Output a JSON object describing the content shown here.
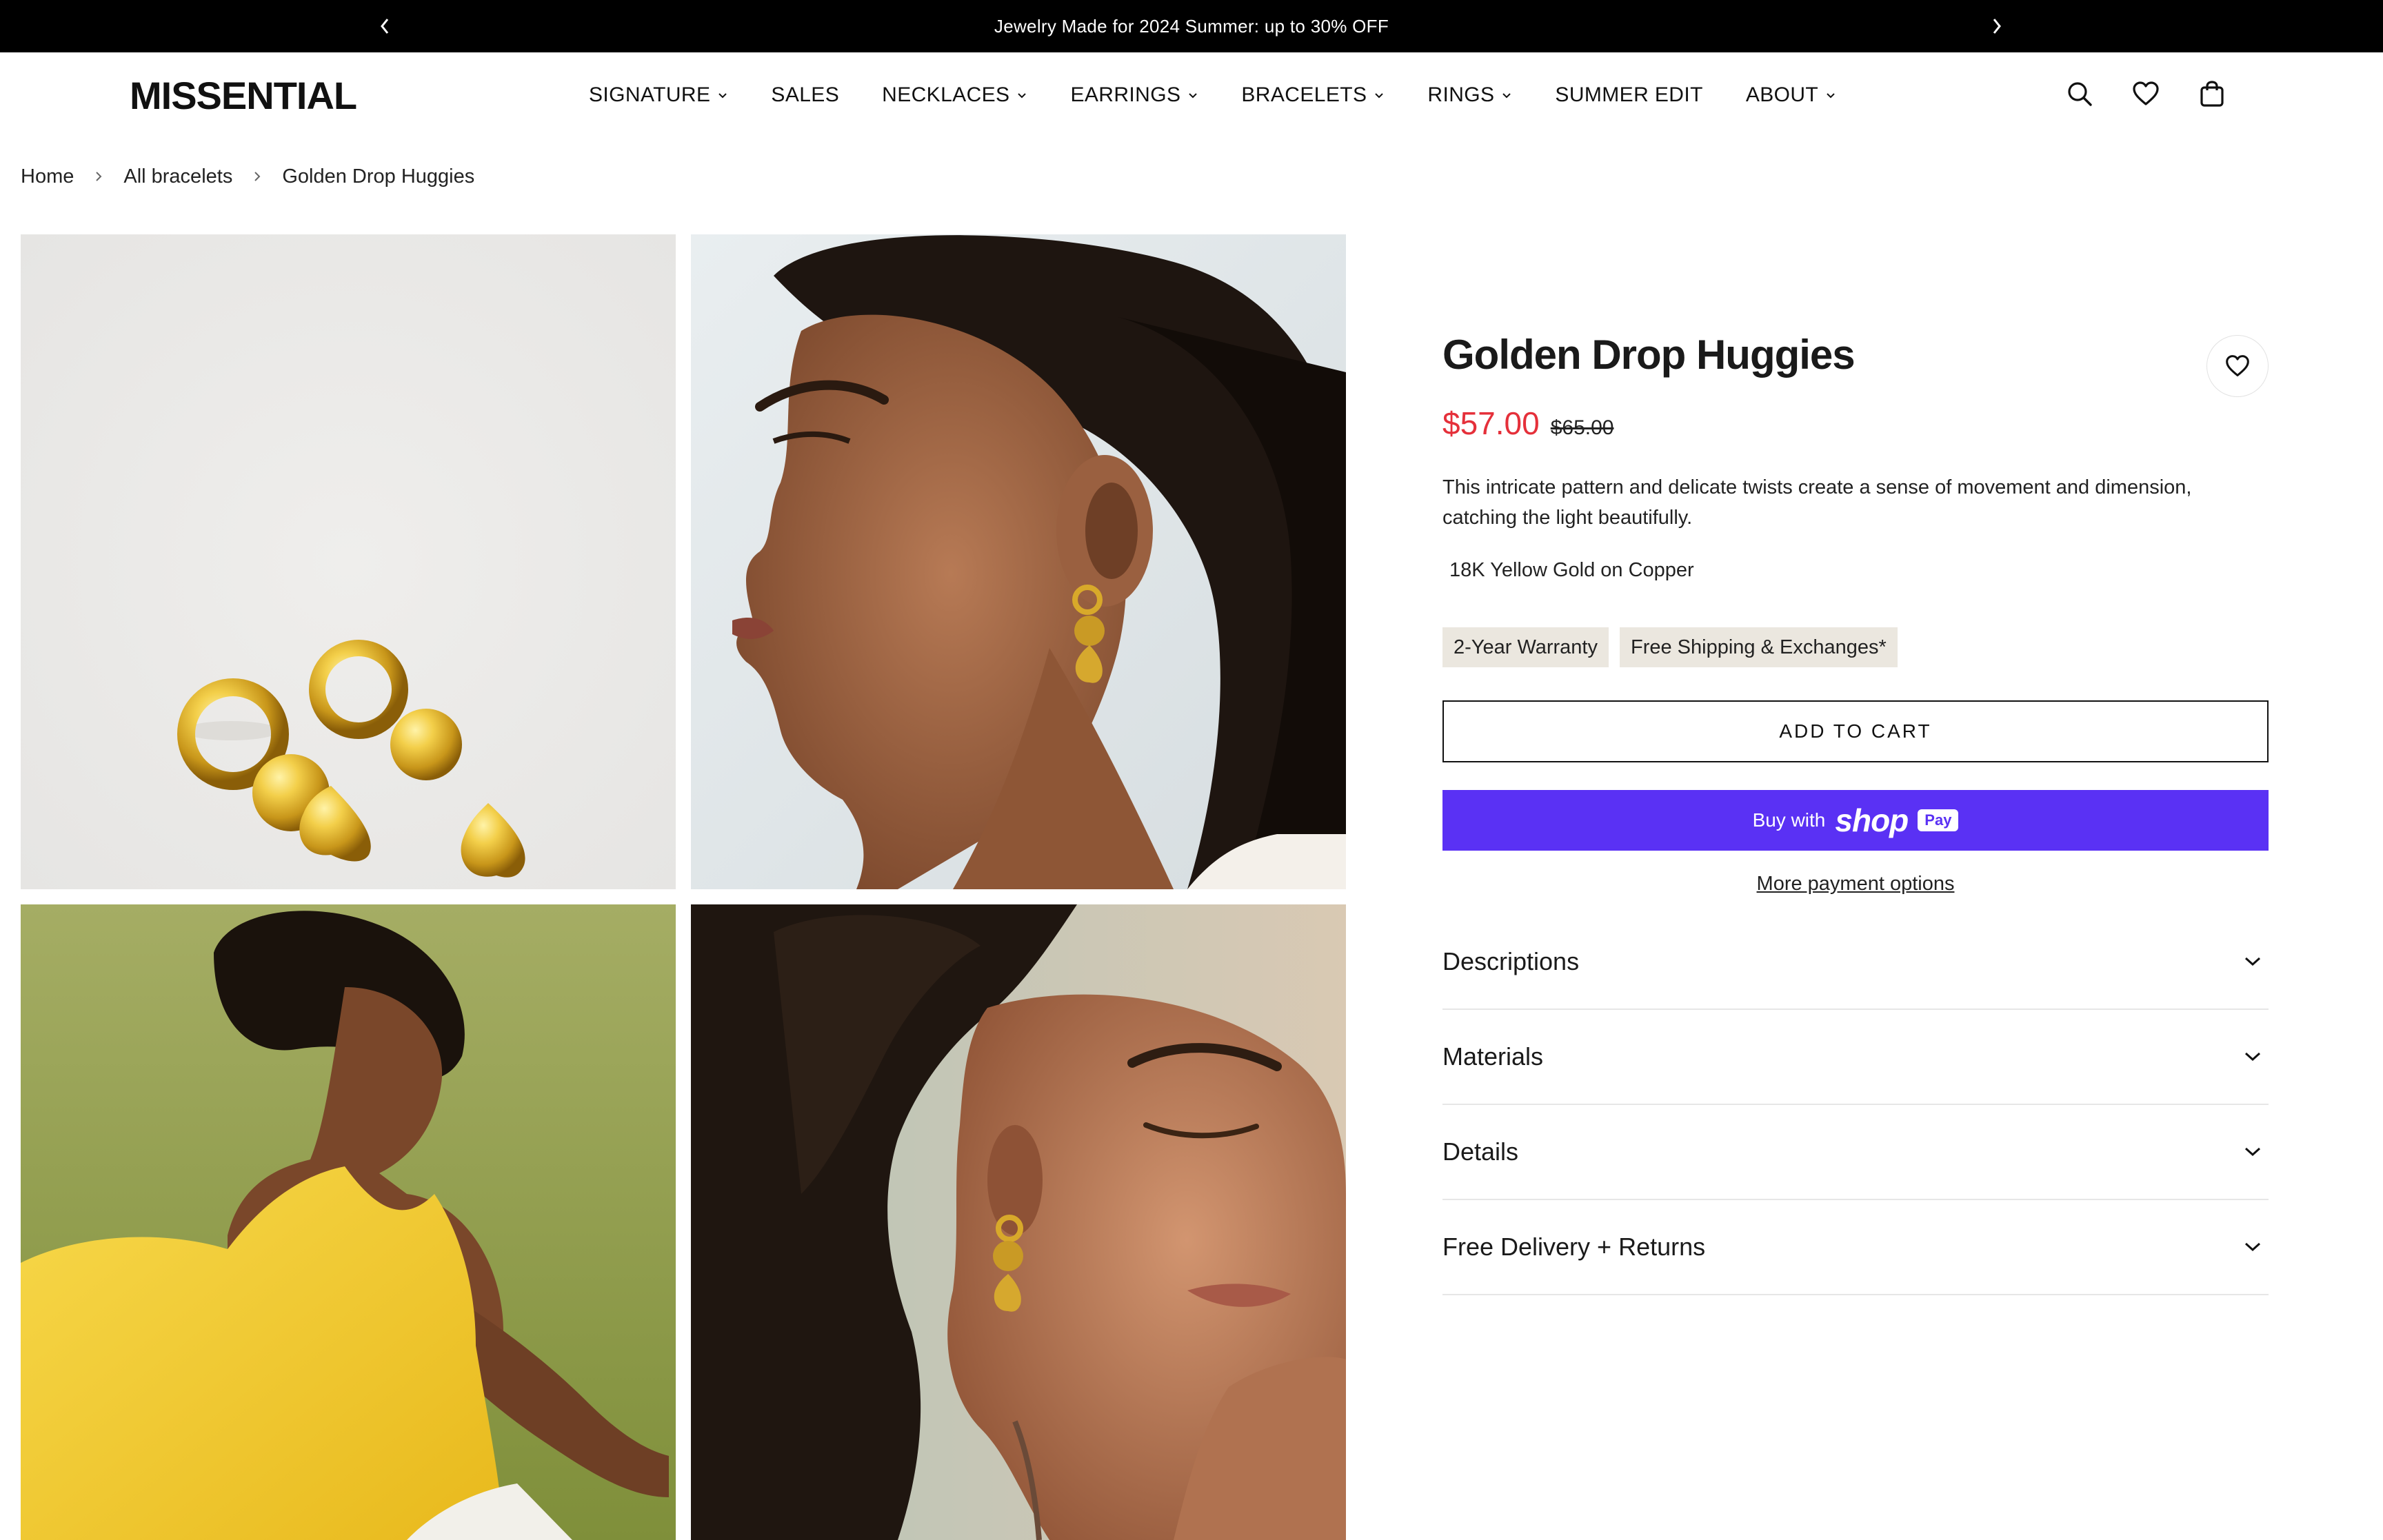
{
  "announcement": {
    "text": "Jewelry Made for 2024 Summer: up to 30% OFF"
  },
  "brand": {
    "logo": "MISSENTIAL"
  },
  "nav": {
    "items": [
      {
        "label": "SIGNATURE",
        "dropdown": true
      },
      {
        "label": "SALES",
        "dropdown": false
      },
      {
        "label": "NECKLACES",
        "dropdown": true
      },
      {
        "label": "EARRINGS",
        "dropdown": true
      },
      {
        "label": "BRACELETS",
        "dropdown": true
      },
      {
        "label": "RINGS",
        "dropdown": true
      },
      {
        "label": "SUMMER EDIT",
        "dropdown": false
      },
      {
        "label": "ABOUT",
        "dropdown": true
      }
    ],
    "icons": [
      "search-icon",
      "heart-icon",
      "bag-icon"
    ]
  },
  "breadcrumb": [
    "Home",
    "All bracelets",
    "Golden Drop Huggies"
  ],
  "product": {
    "title": "Golden Drop Huggies",
    "price": "$57.00",
    "compare_price": "$65.00",
    "description": "This intricate pattern and delicate twists create a sense of movement and dimension, catching the light beautifully.",
    "material": "18K Yellow Gold on Copper",
    "badges": [
      "2-Year Warranty",
      "Free Shipping & Exchanges*"
    ],
    "add_to_cart": "ADD TO CART",
    "buy_with": "Buy with",
    "shop_word": "shop",
    "pay_word": "Pay",
    "more_payment": "More payment options",
    "accordion": [
      "Descriptions",
      "Materials",
      "Details",
      "Free Delivery + Returns"
    ]
  },
  "colors": {
    "announcement_bg": "#000000",
    "sale_price": "#e5303a",
    "shop_pay": "#5a31f4",
    "badge_bg": "#ebe7df"
  }
}
